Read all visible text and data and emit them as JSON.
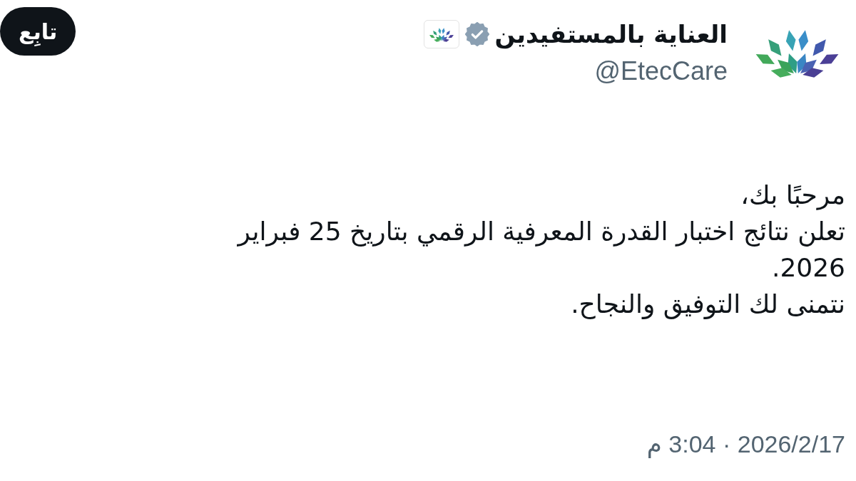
{
  "account": {
    "name": "العناية بالمستفيدين",
    "handle": "@EtecCare",
    "verified": true,
    "affiliate_badge": true
  },
  "follow_button": {
    "label": "تابِع"
  },
  "post": {
    "lines": [
      "مرحبًا بك،",
      "تعلن نتائج اختبار القدرة المعرفية الرقمي بتاريخ 25 فبراير 2026.",
      "نتمنى لك التوفيق والنجاح."
    ],
    "timestamp": "2026/2/17 · 3:04 م"
  }
}
